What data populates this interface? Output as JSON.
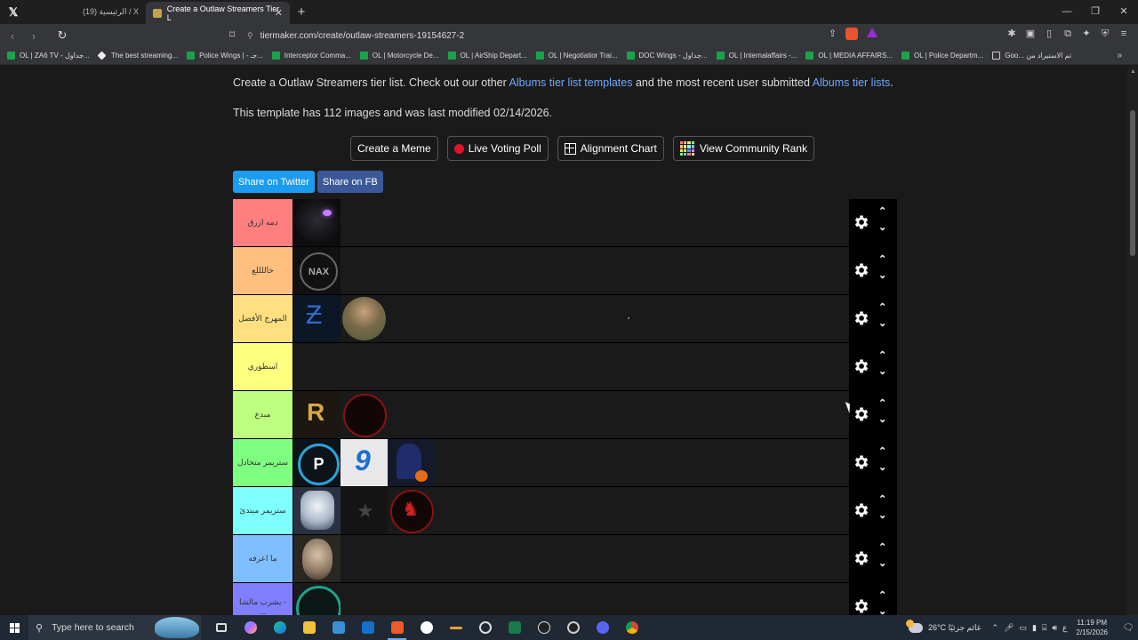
{
  "browser": {
    "tabs": [
      {
        "label": "(19) الرئيسية / X",
        "active": false
      },
      {
        "label": "Create a Outlaw Streamers Tier L",
        "active": true
      }
    ],
    "url": "tiermaker.com/create/outlaw-streamers-19154627-2",
    "bookmarks": [
      {
        "label": "OL | ZA6 TV - جداول...",
        "icon": "sheet-icon"
      },
      {
        "label": "The best streaming...",
        "icon": "diamond-icon"
      },
      {
        "label": "Police Wings | - جـ...",
        "icon": "sheet-icon"
      },
      {
        "label": "Interceptor Comma...",
        "icon": "sheet-icon"
      },
      {
        "label": "OL | Motorcycle De...",
        "icon": "sheet-icon"
      },
      {
        "label": "OL | AirShip Depart...",
        "icon": "sheet-icon"
      },
      {
        "label": "OL | Negotiatior Trai...",
        "icon": "sheet-icon"
      },
      {
        "label": "DOC Wings - جداول...",
        "icon": "sheet-icon"
      },
      {
        "label": "OL | Internalaffairs -...",
        "icon": "sheet-icon"
      },
      {
        "label": "OL | MEDIA AFFAIRS...",
        "icon": "sheet-icon"
      },
      {
        "label": "OL | Police Departm...",
        "icon": "sheet-icon"
      },
      {
        "label": "Goo... تم الاستيراد من",
        "icon": "folder-icon"
      }
    ]
  },
  "page": {
    "intro_prefix": "Create a Outlaw Streamers tier list. Check out our other ",
    "intro_link1": "Albums tier list templates",
    "intro_middle": " and the most recent user submitted ",
    "intro_link2": "Albums tier lists",
    "intro_suffix": ".",
    "meta": "This template has 112 images and was last modified 02/14/2026.",
    "actions": {
      "create_meme": "Create a Meme",
      "live_poll": "Live Voting Poll",
      "alignment": "Alignment Chart",
      "community_rank": "View Community Rank"
    },
    "share": {
      "twitter": "Share on Twitter",
      "fb": "Share on FB"
    },
    "tiers": [
      {
        "label": "دمه ازرق",
        "color": "#ff7f7f",
        "items": [
          "purple-eyes-avatar"
        ]
      },
      {
        "label": "خاللللع",
        "color": "#ffbf7f",
        "items": [
          "nax-logo-avatar"
        ]
      },
      {
        "label": "المهرج الأفضل",
        "color": "#ffdf7f",
        "items": [
          "blue-logo-avatar",
          "soldier-avatar"
        ]
      },
      {
        "label": "اسطوري",
        "color": "#ffff7f",
        "items": []
      },
      {
        "label": "مبدع",
        "color": "#bfff7f",
        "items": [
          "gold-logo-avatar",
          "red-ring-avatar"
        ]
      },
      {
        "label": "ستريمر متخادل",
        "color": "#7fff7f",
        "items": [
          "pd-logo-avatar",
          "nine-logo-avatar",
          "anime-pumpkin-avatar"
        ]
      },
      {
        "label": "ستريمر مبتدئ",
        "color": "#7fffff",
        "items": [
          "white-hair-avatar",
          "dark-stars-avatar",
          "red-knight-avatar"
        ]
      },
      {
        "label": "ما اعرفه",
        "color": "#7fbfff",
        "items": [
          "man-face-avatar"
        ]
      },
      {
        "label": "يشرب مالشا - ...",
        "color": "#7f7fff",
        "items": [
          "teal-ring-avatar"
        ]
      }
    ]
  },
  "taskbar": {
    "search_placeholder": "Type here to search",
    "weather": "26°C  غائم جزئيًا",
    "lang": "ع",
    "time": "11:19 PM",
    "date": "2/15/2026"
  }
}
